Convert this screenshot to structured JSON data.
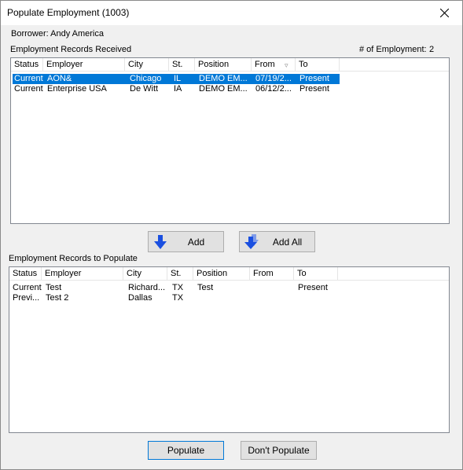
{
  "window": {
    "title": "Populate Employment (1003)"
  },
  "borrower_label": "Borrower: Andy America",
  "received": {
    "section_label": "Employment Records Received",
    "count_label": "# of Employment:",
    "count_value": "2",
    "columns": [
      "Status",
      "Employer",
      "City",
      "St.",
      "Position",
      "From",
      "To"
    ],
    "rows": [
      {
        "status": "Current",
        "employer": "AON&",
        "city": "Chicago",
        "st": "IL",
        "position": "DEMO EM...",
        "from": "07/19/2...",
        "to": "Present",
        "selected": true
      },
      {
        "status": "Current",
        "employer": "Enterprise USA",
        "city": "De Witt",
        "st": "IA",
        "position": "DEMO EM...",
        "from": "06/12/2...",
        "to": "Present",
        "selected": false
      }
    ]
  },
  "buttons": {
    "add": "Add",
    "add_all": "Add All",
    "populate": "Populate",
    "dont_populate": "Don't Populate"
  },
  "populate_list": {
    "section_label": "Employment Records to Populate",
    "columns": [
      "Status",
      "Employer",
      "City",
      "St.",
      "Position",
      "From",
      "To"
    ],
    "rows": [
      {
        "status": "Current",
        "employer": "Test",
        "city": "Richard...",
        "st": "TX",
        "position": "Test",
        "from": "",
        "to": "Present"
      },
      {
        "status": "Previ...",
        "employer": "Test 2",
        "city": "Dallas",
        "st": "TX",
        "position": "",
        "from": "",
        "to": ""
      }
    ]
  },
  "colors": {
    "selection": "#0078d7",
    "arrow": "#1a4fe0"
  },
  "icons": [
    "close-icon",
    "down-arrow-icon",
    "multi-down-arrow-icon",
    "sort-indicator-icon"
  ]
}
